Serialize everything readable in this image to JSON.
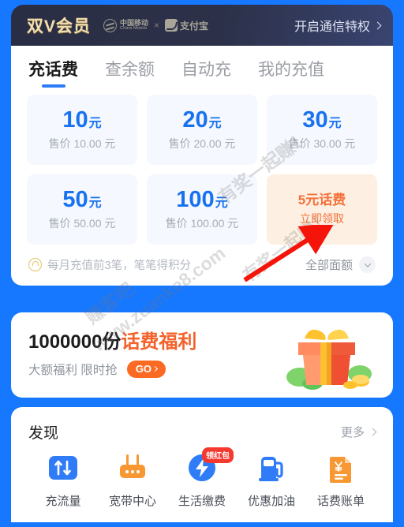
{
  "header": {
    "vip_title": "双V会员",
    "partner_cn": "中国移动",
    "partner_en": "China Mobile",
    "separator": "×",
    "partner2": "支付宝",
    "cta_label": "开启通信特权",
    "chevron_icon": "chevron-right-icon"
  },
  "tabs": [
    {
      "label": "充话费",
      "active": true
    },
    {
      "label": "查余额",
      "active": false
    },
    {
      "label": "自动充",
      "active": false
    },
    {
      "label": "我的充值",
      "active": false
    }
  ],
  "denominations": [
    {
      "amount": "10",
      "unit": "元",
      "price": "售价 10.00 元",
      "promo": false
    },
    {
      "amount": "20",
      "unit": "元",
      "price": "售价 20.00 元",
      "promo": false
    },
    {
      "amount": "30",
      "unit": "元",
      "price": "售价 30.00 元",
      "promo": false
    },
    {
      "amount": "50",
      "unit": "元",
      "price": "售价 50.00 元",
      "promo": false
    },
    {
      "amount": "100",
      "unit": "元",
      "price": "售价 100.00 元",
      "promo": false
    },
    {
      "amount": "",
      "unit": "",
      "price": "",
      "promo": true,
      "promo_title": "5元话费",
      "promo_sub": "立即领取"
    }
  ],
  "points_row": {
    "badge_icon": "points-medal-icon",
    "text": "每月充值前3笔，笔笔得积分",
    "filter_label": "全部面额",
    "filter_icon": "chevron-down-icon"
  },
  "promo_banner": {
    "head_number": "1000000份",
    "head_highlight": "话费福利",
    "sub_text": "大额福利 限时抢",
    "go_label": "GO",
    "gift_icon": "gift-box-icon"
  },
  "discover": {
    "title": "发现",
    "more_label": "更多",
    "more_icon": "chevron-right-icon",
    "shortcuts": [
      {
        "label": "充流量",
        "icon": "data-recharge-icon",
        "badge": ""
      },
      {
        "label": "宽带中心",
        "icon": "router-broadband-icon",
        "badge": ""
      },
      {
        "label": "生活缴费",
        "icon": "lightning-payment-icon",
        "badge": "领红包"
      },
      {
        "label": "优惠加油",
        "icon": "fuel-pump-icon",
        "badge": ""
      },
      {
        "label": "话费账单",
        "icon": "bill-invoice-icon",
        "badge": ""
      }
    ]
  },
  "watermark": {
    "line1": "有奖一起赚！",
    "line2": "赚客吧",
    "line3": "www.zuanke8.com",
    "line4": "有奖一起赚！"
  },
  "colors": {
    "page_bg": "#1677ff",
    "header_bg": "#2c3149",
    "vip_gold": "#f3dfae",
    "accent_blue": "#1872f0",
    "promo_orange": "#f4703a",
    "badge_red": "#f5392f"
  }
}
